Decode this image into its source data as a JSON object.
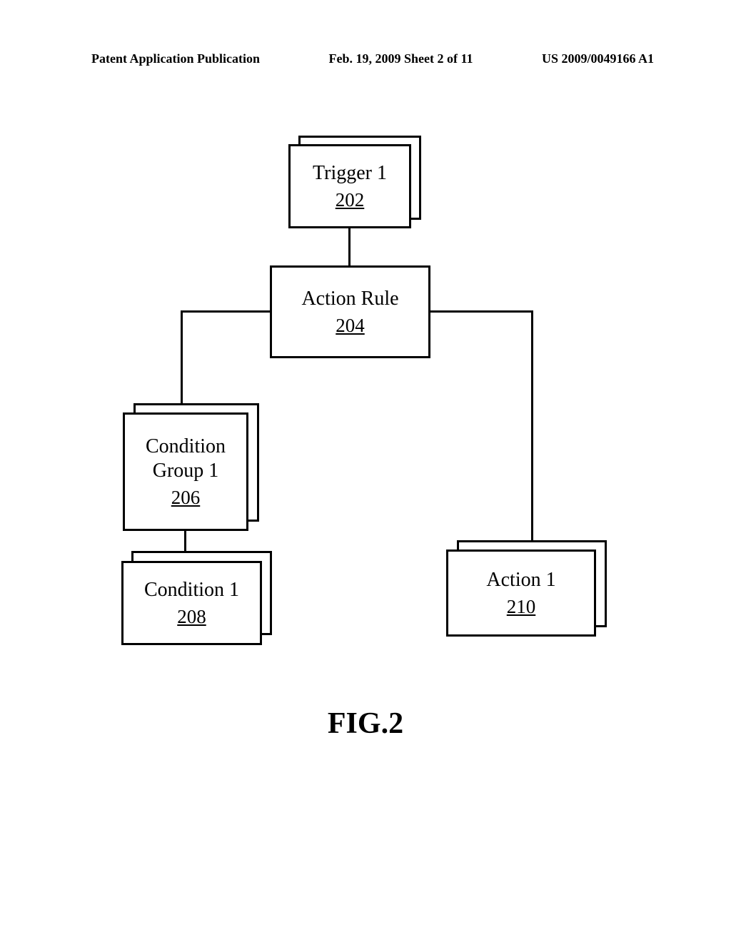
{
  "header": {
    "left": "Patent Application Publication",
    "center": "Feb. 19, 2009  Sheet 2 of 11",
    "right": "US 2009/0049166 A1"
  },
  "diagram": {
    "trigger": {
      "title": "Trigger 1",
      "num": "202"
    },
    "action_rule": {
      "title": "Action Rule",
      "num": "204"
    },
    "condition_group": {
      "title": "Condition\nGroup 1",
      "num": "206"
    },
    "condition": {
      "title": "Condition 1",
      "num": "208"
    },
    "action": {
      "title": "Action 1",
      "num": "210"
    }
  },
  "figure_label": "FIG.2"
}
